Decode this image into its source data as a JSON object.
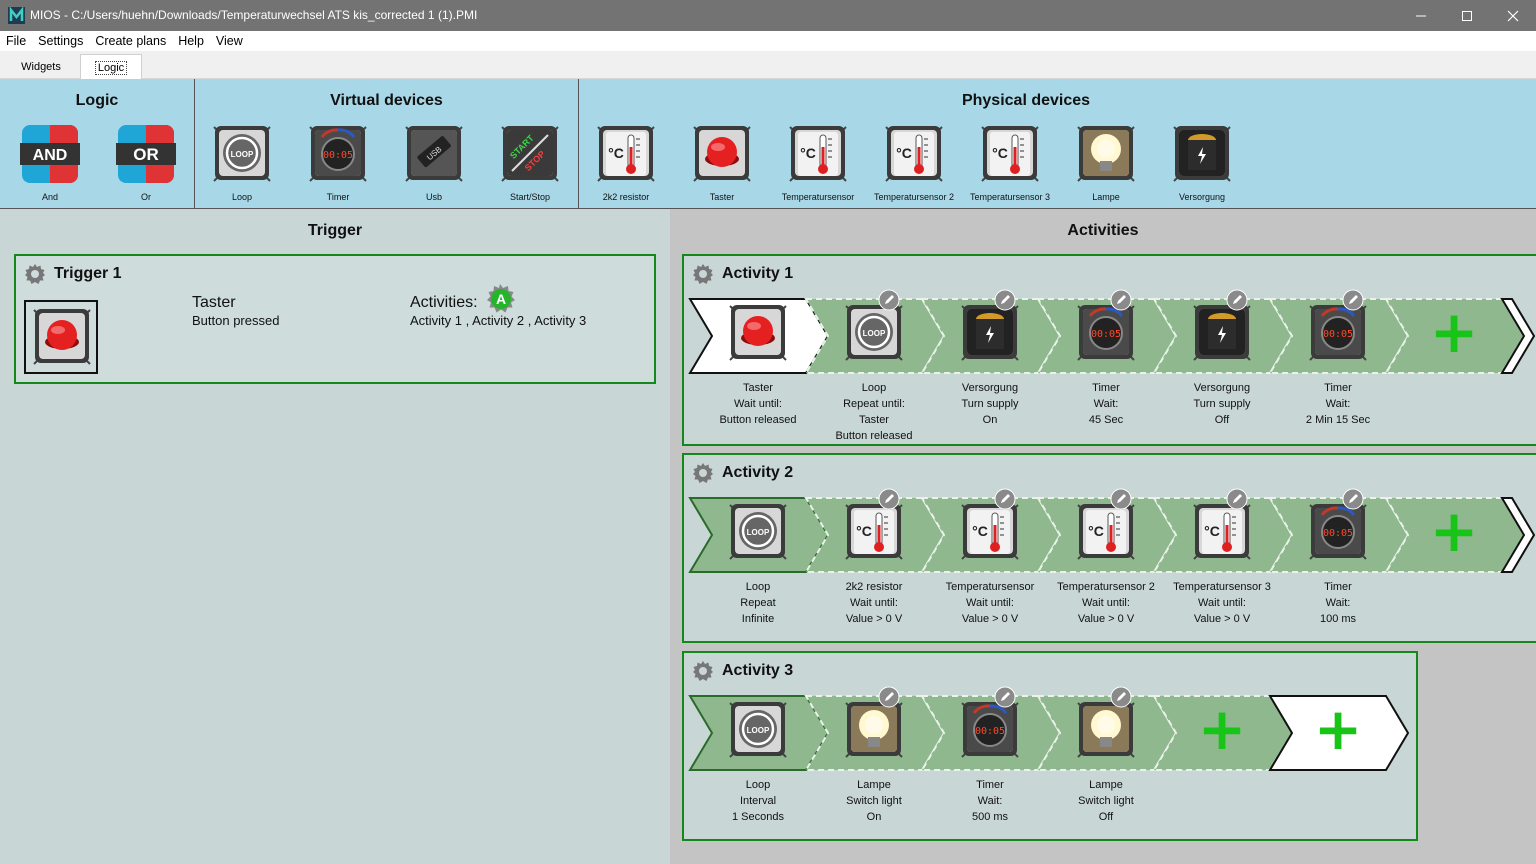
{
  "window": {
    "title": "MIOS - C:/Users/huehn/Downloads/Temperaturwechsel ATS kis_corrected 1 (1).PMI"
  },
  "menu": [
    "File",
    "Settings",
    "Create plans",
    "Help",
    "View"
  ],
  "tabs": [
    "Widgets",
    "Logic"
  ],
  "palette": {
    "groups": {
      "logic": "Logic",
      "virtual": "Virtual devices",
      "physical": "Physical devices"
    },
    "logic": [
      {
        "label": "And",
        "text": "AND"
      },
      {
        "label": "Or",
        "text": "OR"
      }
    ],
    "virtual": [
      {
        "label": "Loop"
      },
      {
        "label": "Timer"
      },
      {
        "label": "Usb"
      },
      {
        "label": "Start/Stop"
      }
    ],
    "physical": [
      {
        "label": "2k2 resistor"
      },
      {
        "label": "Taster"
      },
      {
        "label": "Temperatursensor"
      },
      {
        "label": "Temperatursensor 2"
      },
      {
        "label": "Temperatursensor 3"
      },
      {
        "label": "Lampe"
      },
      {
        "label": "Versorgung"
      }
    ]
  },
  "trigger_panel": {
    "title": "Trigger",
    "card": {
      "name": "Trigger 1",
      "device": "Taster",
      "event": "Button pressed",
      "activities_label": "Activities:",
      "activities_list": "Activity 1 , Activity 2 , Activity 3",
      "badge": "A"
    }
  },
  "activities_panel": {
    "title": "Activities",
    "activities": [
      {
        "name": "Activity 1",
        "steps": [
          {
            "icon": "taster",
            "lines": [
              "Taster",
              "Wait until:",
              "Button released"
            ]
          },
          {
            "icon": "loop",
            "lines": [
              "Loop",
              "Repeat until:",
              "Taster",
              "Button released"
            ]
          },
          {
            "icon": "battery",
            "lines": [
              "Versorgung",
              "Turn supply",
              "On"
            ]
          },
          {
            "icon": "timer",
            "lines": [
              "Timer",
              "Wait:",
              "45 Sec"
            ]
          },
          {
            "icon": "battery",
            "lines": [
              "Versorgung",
              "Turn supply",
              "Off"
            ]
          },
          {
            "icon": "timer",
            "lines": [
              "Timer",
              "Wait:",
              "2 Min 15 Sec"
            ]
          }
        ]
      },
      {
        "name": "Activity 2",
        "steps": [
          {
            "icon": "loop",
            "lines": [
              "Loop",
              "Repeat",
              "Infinite"
            ]
          },
          {
            "icon": "thermo",
            "lines": [
              "2k2 resistor",
              "Wait until:",
              "Value > 0 V"
            ]
          },
          {
            "icon": "thermo",
            "lines": [
              "Temperatursensor",
              "Wait until:",
              "Value > 0 V"
            ]
          },
          {
            "icon": "thermo",
            "lines": [
              "Temperatursensor 2",
              "Wait until:",
              "Value > 0 V"
            ]
          },
          {
            "icon": "thermo",
            "lines": [
              "Temperatursensor 3",
              "Wait until:",
              "Value > 0 V"
            ]
          },
          {
            "icon": "timer",
            "lines": [
              "Timer",
              "Wait:",
              "100 ms"
            ]
          }
        ]
      },
      {
        "name": "Activity 3",
        "steps": [
          {
            "icon": "loop",
            "lines": [
              "Loop",
              "Interval",
              "1 Seconds"
            ]
          },
          {
            "icon": "lamp",
            "lines": [
              "Lampe",
              "Switch light",
              "On"
            ]
          },
          {
            "icon": "timer",
            "lines": [
              "Timer",
              "Wait:",
              "500 ms"
            ]
          },
          {
            "icon": "lamp",
            "lines": [
              "Lampe",
              "Switch light",
              "Off"
            ]
          }
        ]
      }
    ]
  },
  "icon_text": {
    "loop": "LOOP",
    "timer": "00:05",
    "usb": "USB",
    "start": "START",
    "stop": "STOP",
    "celsius": "°C",
    "add": "+"
  },
  "colors": {
    "titlebar": "#737373",
    "palette": "#a8d8e8",
    "trigger_bg": "#c9d6d6",
    "activity_bg": "#c4c4c4",
    "card_border": "#14881a",
    "chevron": "#8fb88f",
    "add": "#19c419"
  }
}
